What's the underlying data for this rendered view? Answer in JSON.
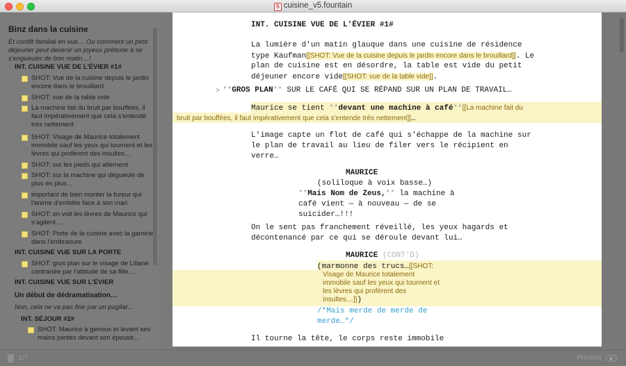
{
  "window": {
    "title": "cuisine_v5.fountain",
    "icon": "fountain-doc-icon"
  },
  "sidebar": {
    "title": "Binz dans la cuisine",
    "synopsis": "Et conflit familial en vue… Ou comment un petit déjeuner peut devenir un joyeux prétexte à se s'engueuler de bon matin…!",
    "scene1": "INT. CUISINE VUE DE L'ÉVIER #1#",
    "notes1": [
      "SHOT: Vue de la cuisine depuis le jardin encore dans le brouillard",
      "SHOT: vue de la table vide",
      "La machine fait du bruit par bouffées, il faut impérativement que cela s'entende très nettement",
      "SHOT: Visage de Maurice totalement immobile sauf les yeux qui tournent et les lèvres qui profèrent des insultes…",
      "SHOT: sur les pieds qui alternent",
      "SHOT: sur la machine qui dégueule de plus en plus…",
      "important de bien monter la fureur qui l'anime d'emblée face à son mari",
      "SHOT: on voit les lèvres de Maurice qui s'agitent…",
      "SHOT: Porte de la cuisine avec la gamine dans l'embrasure"
    ],
    "scene2": "INT. CUISINE VUE SUR LA PORTE",
    "notes2": [
      "SHOT: gros plan sur le visage de Liliane contrariée par l'attitude de sa fille…"
    ],
    "scene3": "INT. CUISINE VUE SUR L'ÉVIER",
    "section2": "Un début de dédramatisation…",
    "synopsis2": "Non, cela ne va pas finir par un pugilat…",
    "scene4": "INT. SÉJOUR #2#",
    "notes4": [
      "SHOT: Maurice à genoux et levant ses mains jointes devant son épouse…"
    ]
  },
  "editor": {
    "heading": "INT. CUISINE VUE DE L'ÉVIER #1#",
    "action1_l1": "La lumière d'un matin glauque dans une cuisine de résidence",
    "action1_l2a": "type Kaufman",
    "note_a": "[[SHOT: Vue de la cuisine depuis le jardin encore dans le brouillard]]",
    "action1_l2b": ". Le",
    "action1_l3": "plan de cuisine est en désordre, la table est vide du petit",
    "action1_l4a": "déjeuner encore vide",
    "note_b": "[[SHOT: vue de la table vide]]",
    "action1_l4b": ".",
    "section_marker": ">",
    "bold_open": "**",
    "bold_gros_plan": "GROS PLAN",
    "bold_close": "**",
    "section_rest": " SUR LE CAFÉ QUI SE RÉPAND SUR UN PLAN DE TRAVAIL…",
    "action2_a": "Maurice se tient ",
    "action2_bold": "devant une machine à café",
    "note_c1": "[[La machine fait du",
    "note_c2": "bruit par bouffées, il faut impérativement que cela s'entende très nettement]]",
    "note_c_tail": "…",
    "action3_l1": "L'image capte un flot de café qui s'échappe de la machine sur",
    "action3_l2": "le plan de travail au lieu de filer vers le récipient en",
    "action3_l3": "verre…",
    "char1": "MAURICE",
    "paren1": "(soliloque à voix basse…)",
    "dlg1_bold": "Mais Nom de Zeus,",
    "dlg1_rest": " la machine à",
    "dlg1_l2": "café vient — à nouveau — de se",
    "dlg1_l3": "suicider…!!!",
    "action4_l1": "On le sent pas franchement réveillé, les yeux hagards et",
    "action4_l2": "décontenancé par ce qui se déroule devant lui…",
    "char2": "MAURICE",
    "contd": "(CONT'D)",
    "paren2": "(marmonne des trucs…",
    "note_d1": "[[SHOT:",
    "note_d2": "Visage de Maurice totalement",
    "note_d3": "immobile sauf les yeux qui tournent et",
    "note_d4": "les lèvres qui profèrent des",
    "note_d5": "insultes…]]",
    "note_d_tail": ")",
    "boneyard_l1": "/*Mais merde de merde de",
    "boneyard_l2": "merde…*/",
    "action5": "Il tourne la tête, le corps reste immobile"
  },
  "status": {
    "page": "1/7",
    "preview": "Preview"
  },
  "colors": {
    "note_bg": "#fbf4c6",
    "boneyard": "#3b9fd0",
    "sidebar_bg": "#7c7c7c"
  }
}
